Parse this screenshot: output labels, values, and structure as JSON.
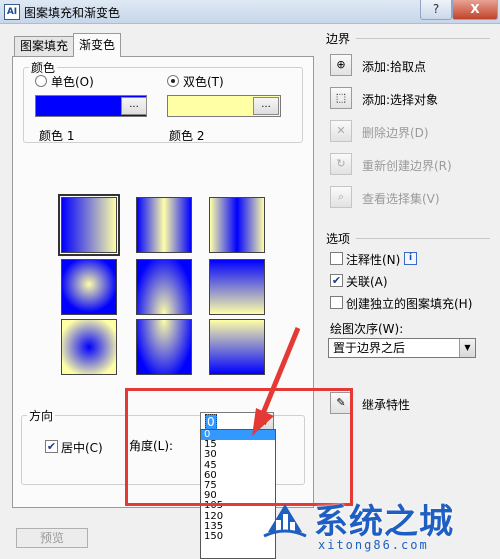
{
  "window": {
    "icon_text": "AI",
    "title": "图案填充和渐变色",
    "help_label": "?",
    "close_label": "X"
  },
  "tabs": [
    {
      "label": "图案填充",
      "active": false
    },
    {
      "label": "渐变色",
      "active": true
    }
  ],
  "color_group": {
    "label": "颜色",
    "one_color_label": "单色(O)",
    "two_color_label": "双色(T)",
    "selected": "two_color",
    "color1_value": "#0000ff",
    "color2_value": "#ffffa6",
    "dots_label": "...",
    "color1_label": "颜色 1",
    "color2_label": "颜色 2"
  },
  "gradient_patterns": [
    {
      "name": "linear",
      "selected": true
    },
    {
      "name": "cylinder",
      "selected": false
    },
    {
      "name": "inverted-cylinder",
      "selected": false
    },
    {
      "name": "spherical",
      "selected": false
    },
    {
      "name": "hemispherical",
      "selected": false
    },
    {
      "name": "curved",
      "selected": false
    },
    {
      "name": "inverted-spherical",
      "selected": false
    },
    {
      "name": "inverted-hemispherical",
      "selected": false
    },
    {
      "name": "inverted-curved",
      "selected": false
    }
  ],
  "orientation": {
    "label": "方向",
    "centered_label": "居中(C)",
    "centered_checked": true,
    "angle_label": "角度(L):",
    "angle_value": "0",
    "angle_options": [
      "0",
      "15",
      "30",
      "45",
      "60",
      "75",
      "90",
      "105",
      "120",
      "135",
      "150"
    ],
    "highlighted_option": "0"
  },
  "boundaries": {
    "label": "边界",
    "items": [
      {
        "label": "添加:拾取点",
        "icon": "pick-points-icon",
        "enabled": true
      },
      {
        "label": "添加:选择对象",
        "icon": "select-objects-icon",
        "enabled": true
      },
      {
        "label": "删除边界(D)",
        "icon": "remove-boundaries-icon",
        "enabled": false
      },
      {
        "label": "重新创建边界(R)",
        "icon": "recreate-boundary-icon",
        "enabled": false
      },
      {
        "label": "查看选择集(V)",
        "icon": "view-selections-icon",
        "enabled": false
      }
    ]
  },
  "options": {
    "label": "选项",
    "annotative_label": "注释性(N)",
    "annotative_checked": false,
    "associative_label": "关联(A)",
    "associative_checked": true,
    "separate_label": "创建独立的图案填充(H)",
    "separate_checked": false,
    "info_label": "i",
    "draw_order_label": "绘图次序(W):",
    "draw_order_value": "置于边界之后"
  },
  "inherit": {
    "label": "继承特性"
  },
  "preview": {
    "label": "预览"
  },
  "watermark": {
    "main": "系统之城",
    "sub": "xitong86.com"
  },
  "colors": {
    "accent_red": "#e53935",
    "highlight": "#3399ff",
    "brand_blue": "#1f5fc2"
  }
}
